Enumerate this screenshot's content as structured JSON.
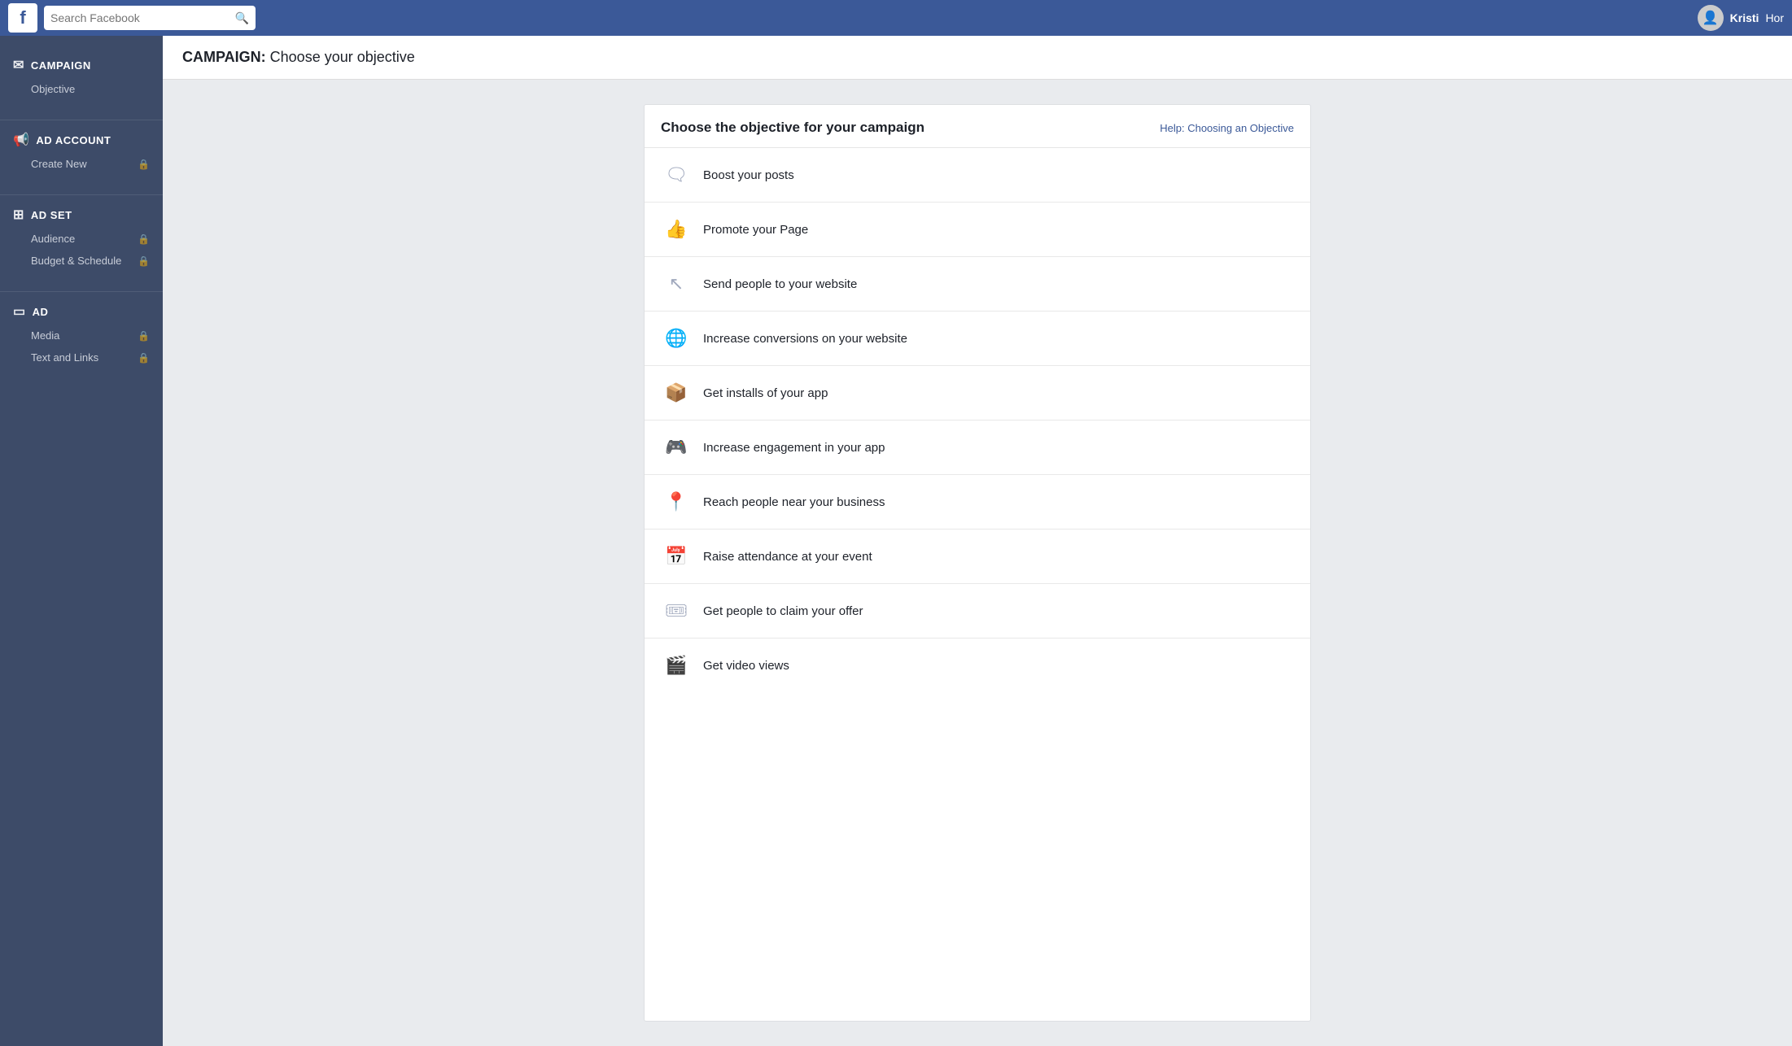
{
  "topnav": {
    "logo": "f",
    "search_placeholder": "Search Facebook",
    "user_name": "Kristi",
    "home_link": "Hor"
  },
  "page_header": {
    "section_bold": "CAMPAIGN:",
    "section_rest": " Choose your objective"
  },
  "sidebar": {
    "sections": [
      {
        "id": "campaign",
        "title": "CAMPAIGN",
        "icon": "✉",
        "items": [
          {
            "label": "Objective",
            "locked": false
          }
        ]
      },
      {
        "id": "ad-account",
        "title": "AD ACCOUNT",
        "icon": "📢",
        "items": [
          {
            "label": "Create New",
            "locked": true
          }
        ]
      },
      {
        "id": "ad-set",
        "title": "AD SET",
        "icon": "⊞",
        "items": [
          {
            "label": "Audience",
            "locked": true
          },
          {
            "label": "Budget & Schedule",
            "locked": true
          }
        ]
      },
      {
        "id": "ad",
        "title": "AD",
        "icon": "▭",
        "items": [
          {
            "label": "Media",
            "locked": true
          },
          {
            "label": "Text and Links",
            "locked": true
          }
        ]
      }
    ]
  },
  "objectives_card": {
    "title": "Choose the objective for your campaign",
    "help_link": "Help: Choosing an Objective",
    "objectives": [
      {
        "id": "boost-posts",
        "label": "Boost your posts",
        "icon": "🗨"
      },
      {
        "id": "promote-page",
        "label": "Promote your Page",
        "icon": "👍"
      },
      {
        "id": "send-website",
        "label": "Send people to your website",
        "icon": "↖"
      },
      {
        "id": "increase-conversions",
        "label": "Increase conversions on your website",
        "icon": "🌐"
      },
      {
        "id": "app-installs",
        "label": "Get installs of your app",
        "icon": "📦"
      },
      {
        "id": "app-engagement",
        "label": "Increase engagement in your app",
        "icon": "🎮"
      },
      {
        "id": "local-awareness",
        "label": "Reach people near your business",
        "icon": "📍"
      },
      {
        "id": "event-responses",
        "label": "Raise attendance at your event",
        "icon": "📅"
      },
      {
        "id": "offer-claims",
        "label": "Get people to claim your offer",
        "icon": "🎟"
      },
      {
        "id": "video-views",
        "label": "Get video views",
        "icon": "🎬"
      }
    ]
  }
}
